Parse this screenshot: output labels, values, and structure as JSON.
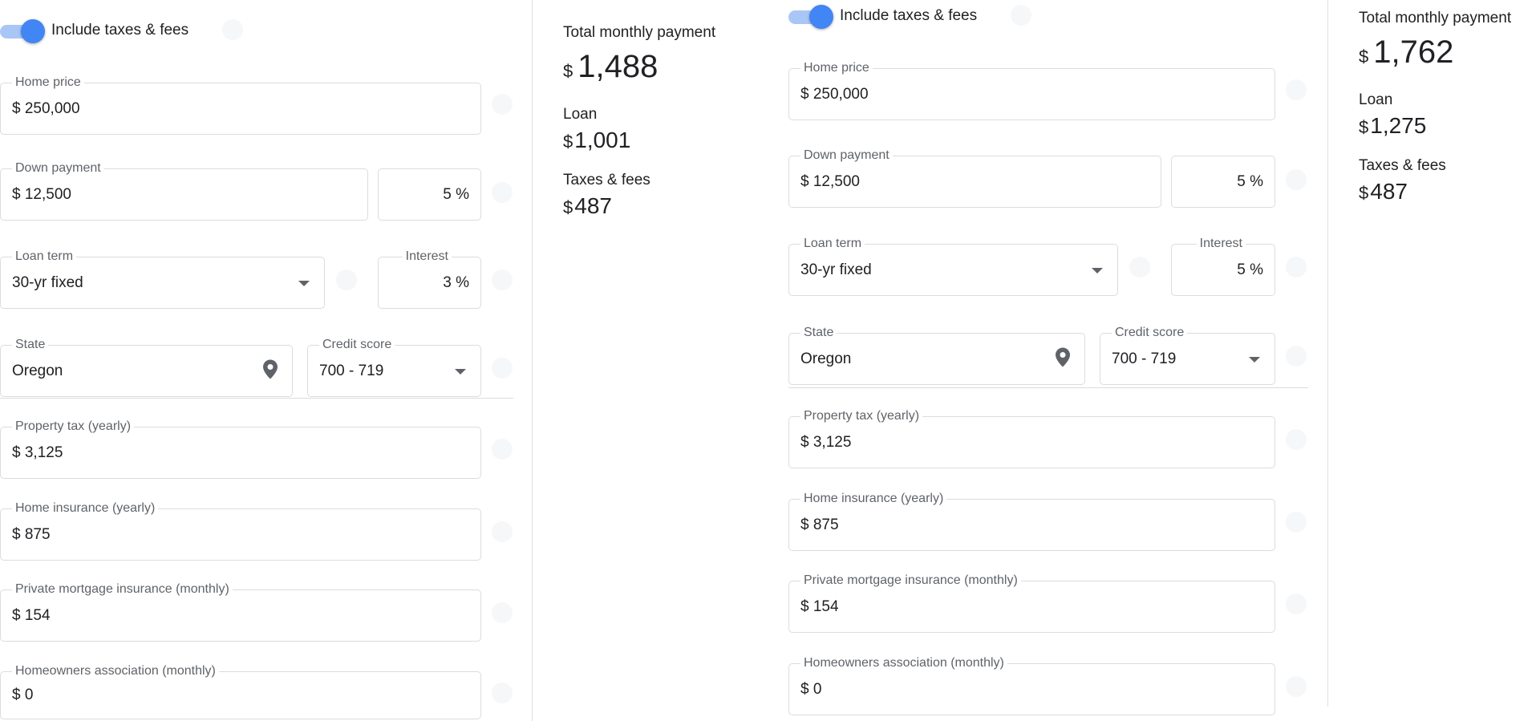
{
  "calculators": [
    {
      "toggle_label": "Include taxes & fees",
      "home_price": {
        "label": "Home price",
        "value": "$ 250,000"
      },
      "down_payment": {
        "label": "Down payment",
        "value": "$ 12,500",
        "percent": "5 %"
      },
      "loan_term": {
        "label": "Loan term",
        "value": "30-yr fixed"
      },
      "interest": {
        "label": "Interest",
        "value": "3 %"
      },
      "state": {
        "label": "State",
        "value": "Oregon"
      },
      "credit_score": {
        "label": "Credit score",
        "value": "700 - 719"
      },
      "property_tax": {
        "label": "Property tax (yearly)",
        "value": "$ 3,125"
      },
      "home_insurance": {
        "label": "Home insurance (yearly)",
        "value": "$ 875"
      },
      "pmi": {
        "label": "Private mortgage insurance (monthly)",
        "value": "$ 154"
      },
      "hoa": {
        "label": "Homeowners association (monthly)",
        "value": "$ 0"
      },
      "summary": {
        "total_label": "Total monthly payment",
        "currency": "$",
        "total": "1,488",
        "loan_label": "Loan",
        "loan": "1,001",
        "taxes_label": "Taxes & fees",
        "taxes": "487"
      }
    },
    {
      "toggle_label": "Include taxes & fees",
      "home_price": {
        "label": "Home price",
        "value": "$ 250,000"
      },
      "down_payment": {
        "label": "Down payment",
        "value": "$ 12,500",
        "percent": "5 %"
      },
      "loan_term": {
        "label": "Loan term",
        "value": "30-yr fixed"
      },
      "interest": {
        "label": "Interest",
        "value": "5 %"
      },
      "state": {
        "label": "State",
        "value": "Oregon"
      },
      "credit_score": {
        "label": "Credit score",
        "value": "700 - 719"
      },
      "property_tax": {
        "label": "Property tax (yearly)",
        "value": "$ 3,125"
      },
      "home_insurance": {
        "label": "Home insurance (yearly)",
        "value": "$ 875"
      },
      "pmi": {
        "label": "Private mortgage insurance (monthly)",
        "value": "$ 154"
      },
      "hoa": {
        "label": "Homeowners association (monthly)",
        "value": "$ 0"
      },
      "summary": {
        "total_label": "Total monthly payment",
        "currency": "$",
        "total": "1,762",
        "loan_label": "Loan",
        "loan": "1,275",
        "taxes_label": "Taxes & fees",
        "taxes": "487"
      }
    }
  ],
  "colors": {
    "accent": "#4285f4",
    "accent_track": "#a9c6f6",
    "border": "#dadce0",
    "label": "#5f6368",
    "text": "#202124"
  },
  "icons": {
    "state_field": "location-pin-icon",
    "dropdowns": "chevron-down-icon"
  }
}
